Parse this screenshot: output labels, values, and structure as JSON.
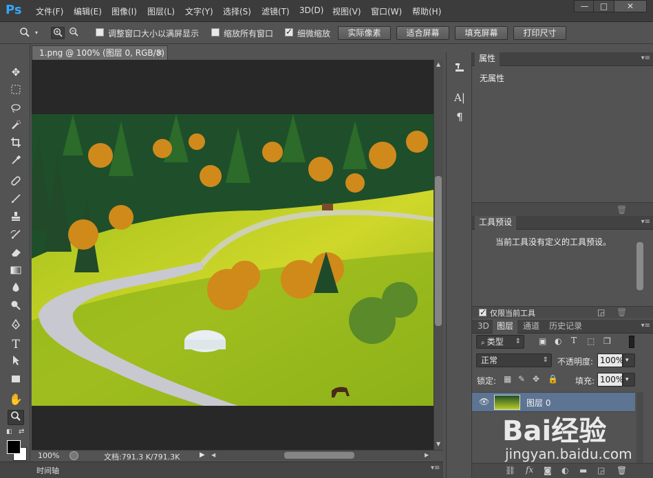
{
  "app": {
    "logo": "Ps"
  },
  "menu": [
    "文件(F)",
    "编辑(E)",
    "图像(I)",
    "图层(L)",
    "文字(Y)",
    "选择(S)",
    "滤镜(T)",
    "3D(D)",
    "视图(V)",
    "窗口(W)",
    "帮助(H)"
  ],
  "window_controls": {
    "minimize": "—",
    "maximize": "□",
    "close": "✕"
  },
  "options_bar": {
    "resize_windows_label": "调整窗口大小以满屏显示",
    "resize_windows_checked": false,
    "zoom_all_windows_label": "缩放所有窗口",
    "zoom_all_windows_checked": false,
    "scrubby_zoom_label": "细微缩放",
    "scrubby_zoom_checked": true,
    "actual_pixels": "实际像素",
    "fit_screen": "适合屏幕",
    "fill_screen": "填充屏幕",
    "print_size": "打印尺寸"
  },
  "document": {
    "tab_title": "1.png @ 100% (图层 0, RGB/8)",
    "tab_close": "×",
    "zoom": "100%",
    "doc_info": "文档:791.3 K/791.3K"
  },
  "timeline": {
    "label": "时间轴"
  },
  "properties_panel": {
    "title": "属性",
    "content": "无属性"
  },
  "tool_presets_panel": {
    "title": "工具预设",
    "message": "当前工具没有定义的工具预设。",
    "current_tool_only_label": "仅限当前工具",
    "current_tool_only_checked": true
  },
  "layers_panel": {
    "tabs": [
      "3D",
      "图层",
      "通道",
      "历史记录"
    ],
    "active_tab": "图层",
    "filter_kind": "类型",
    "blend_mode": "正常",
    "opacity_label": "不透明度:",
    "opacity_value": "100%",
    "lock_label": "锁定:",
    "fill_label": "填充:",
    "fill_value": "100%",
    "layers": [
      {
        "name": "图层 0",
        "visible": true,
        "selected": true
      }
    ]
  },
  "watermark": {
    "logo": "Bai经验",
    "url": "jingyan.baidu.com"
  },
  "colors": {
    "ps_blue": "#31a8ff",
    "menubar_bg": "#3c3c3c",
    "workspace_bg": "#535353",
    "canvas_bg": "#282828",
    "selected_layer_bg": "#5d7493"
  },
  "icons": {
    "tools": [
      "move-icon",
      "marquee-icon",
      "lasso-icon",
      "quick-select-icon",
      "crop-icon",
      "eyedropper-icon",
      "healing-brush-icon",
      "brush-icon",
      "clone-stamp-icon",
      "history-brush-icon",
      "eraser-icon",
      "gradient-icon",
      "blur-icon",
      "dodge-icon",
      "pen-icon",
      "type-icon",
      "path-select-icon",
      "rectangle-icon",
      "hand-icon",
      "zoom-icon"
    ]
  }
}
